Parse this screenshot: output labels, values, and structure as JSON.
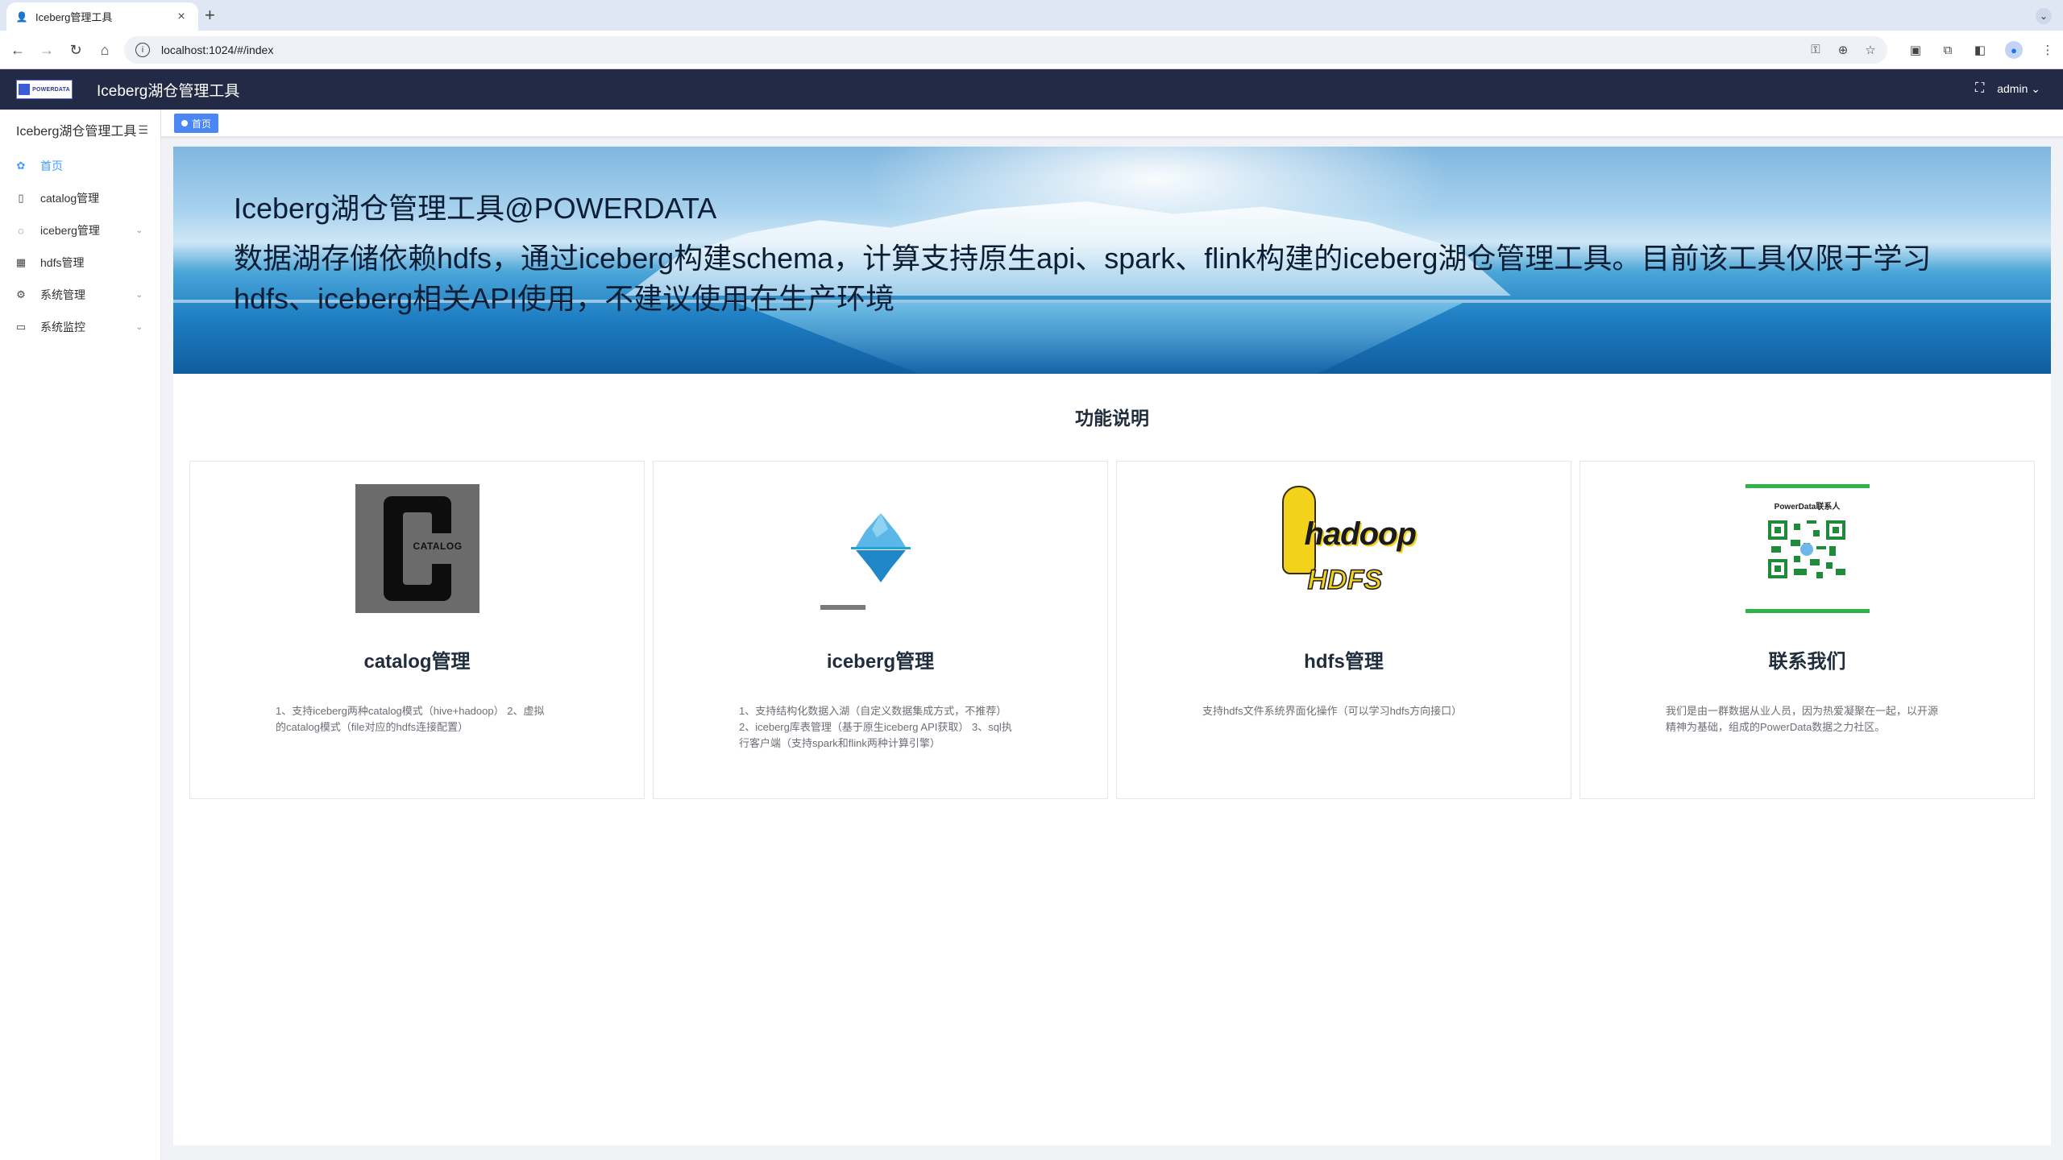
{
  "browser": {
    "tab_title": "Iceberg管理工具",
    "url": "localhost:1024/#/index"
  },
  "header": {
    "logo_text": "POWERDATA",
    "title": "Iceberg湖仓管理工具",
    "user": "admin"
  },
  "sidebar": {
    "title": "Iceberg湖仓管理工具",
    "items": [
      {
        "label": "首页",
        "icon": "dashboard-icon",
        "active": true
      },
      {
        "label": "catalog管理",
        "icon": "document-icon"
      },
      {
        "label": "iceberg管理",
        "icon": "iceberg-icon",
        "has_children": true
      },
      {
        "label": "hdfs管理",
        "icon": "hdfs-icon"
      },
      {
        "label": "系统管理",
        "icon": "gear-icon",
        "has_children": true
      },
      {
        "label": "系统监控",
        "icon": "monitor-icon",
        "has_children": true
      }
    ]
  },
  "tags": {
    "home": "首页"
  },
  "banner": {
    "title": "Iceberg湖仓管理工具@POWERDATA",
    "desc": "数据湖存储依赖hdfs，通过iceberg构建schema，计算支持原生api、spark、flink构建的iceberg湖仓管理工具。目前该工具仅限于学习hdfs、iceberg相关API使用，不建议使用在生产环境"
  },
  "section": {
    "title": "功能说明"
  },
  "cards": [
    {
      "title": "catalog管理",
      "image_text": "CATALOG",
      "desc": "1、支持iceberg两种catalog模式（hive+hadoop） 2、虚拟的catalog模式（file对应的hdfs连接配置）"
    },
    {
      "title": "iceberg管理",
      "desc": "1、支持结构化数据入湖（自定义数据集成方式，不推荐） 2、iceberg库表管理（基于原生iceberg API获取） 3、sql执行客户端（支持spark和flink两种计算引擎）"
    },
    {
      "title": "hdfs管理",
      "image_text_1": "hadoop",
      "image_text_2": "HDFS",
      "desc": "支持hdfs文件系统界面化操作（可以学习hdfs方向接口）"
    },
    {
      "title": "联系我们",
      "qr_caption": "PowerData联系人",
      "desc": "我们是由一群数据从业人员，因为热爱凝聚在一起，以开源精神为基础，组成的PowerData数据之力社区。"
    }
  ],
  "colors": {
    "header_bg": "#222a45",
    "accent": "#409eff",
    "tag_bg": "#4a86f5"
  }
}
